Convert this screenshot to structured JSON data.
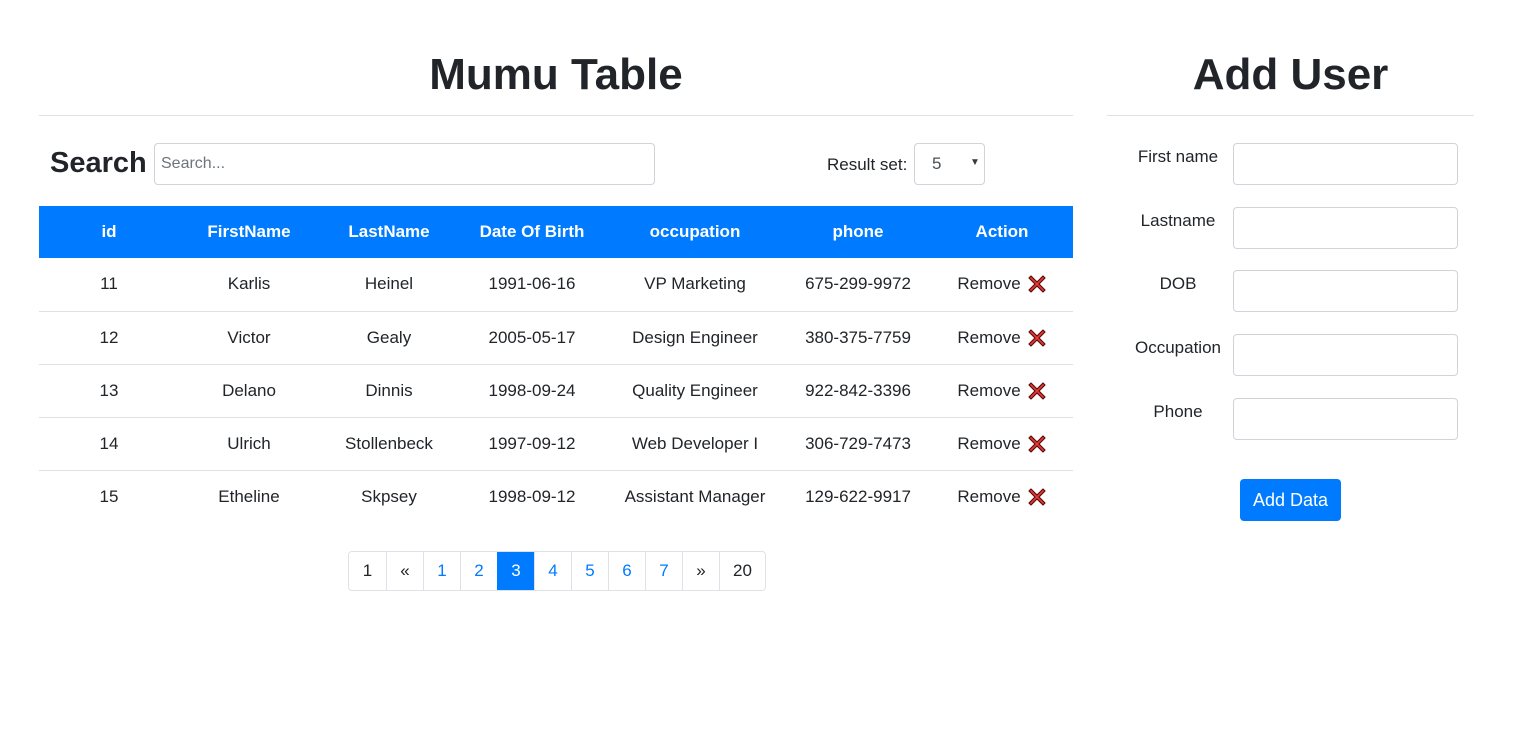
{
  "table_section": {
    "title": "Mumu Table",
    "search_label": "Search",
    "search_placeholder": "Search...",
    "search_value": "",
    "result_set_label": "Result set:",
    "result_set_value": "5",
    "columns": [
      "id",
      "FirstName",
      "LastName",
      "Date Of Birth",
      "occupation",
      "phone",
      "Action"
    ],
    "rows": [
      {
        "id": "11",
        "first": "Karlis",
        "last": "Heinel",
        "dob": "1991-06-16",
        "occupation": "VP Marketing",
        "phone": "675-299-9972",
        "action": "Remove"
      },
      {
        "id": "12",
        "first": "Victor",
        "last": "Gealy",
        "dob": "2005-05-17",
        "occupation": "Design Engineer",
        "phone": "380-375-7759",
        "action": "Remove"
      },
      {
        "id": "13",
        "first": "Delano",
        "last": "Dinnis",
        "dob": "1998-09-24",
        "occupation": "Quality Engineer",
        "phone": "922-842-3396",
        "action": "Remove"
      },
      {
        "id": "14",
        "first": "Ulrich",
        "last": "Stollenbeck",
        "dob": "1997-09-12",
        "occupation": "Web Developer I",
        "phone": "306-729-7473",
        "action": "Remove"
      },
      {
        "id": "15",
        "first": "Etheline",
        "last": "Skpsey",
        "dob": "1998-09-12",
        "occupation": "Assistant Manager",
        "phone": "129-622-9917",
        "action": "Remove"
      }
    ],
    "remove_icon": "red-x-icon",
    "pagination": [
      {
        "label": "1",
        "kind": "first"
      },
      {
        "label": "«",
        "kind": "prev"
      },
      {
        "label": "1",
        "kind": "page"
      },
      {
        "label": "2",
        "kind": "page"
      },
      {
        "label": "3",
        "kind": "page",
        "active": true
      },
      {
        "label": "4",
        "kind": "page"
      },
      {
        "label": "5",
        "kind": "page"
      },
      {
        "label": "6",
        "kind": "page"
      },
      {
        "label": "7",
        "kind": "page"
      },
      {
        "label": "»",
        "kind": "next"
      },
      {
        "label": "20",
        "kind": "last"
      }
    ]
  },
  "form_section": {
    "title": "Add User",
    "fields": [
      {
        "label": "First name",
        "value": ""
      },
      {
        "label": "Lastname",
        "value": ""
      },
      {
        "label": "DOB",
        "value": ""
      },
      {
        "label": "Occupation",
        "value": ""
      },
      {
        "label": "Phone",
        "value": ""
      }
    ],
    "submit_label": "Add Data"
  },
  "colors": {
    "accent": "#007bff",
    "remove_icon_red": "#e53935",
    "border": "#dee2e6"
  }
}
